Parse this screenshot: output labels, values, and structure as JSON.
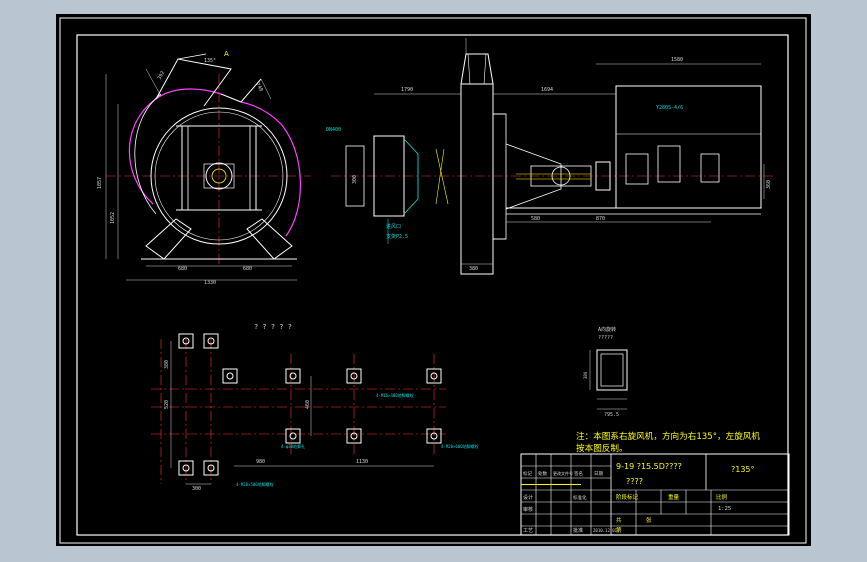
{
  "colors": {
    "background": "#000000",
    "frame": "#ffffff",
    "outline": "#ffffff",
    "dimension": "#d8d8d8",
    "centerline": "#ff3030",
    "volute": "#ff40ff",
    "annotation": "#00d8d8",
    "highlight": "#ffff00",
    "window_chrome": "#b9c6d2"
  },
  "drawing": {
    "detail_title": "? ? ? ? ?",
    "view_label": "A向旋转",
    "view_sub": "?????",
    "note_line1": "注：本图系右旋风机，方向为右135°，左旋风机",
    "note_line2": "按本图反制。",
    "angle_top": "135°",
    "view_letter": "A",
    "motor_label": "Y280S-4/6",
    "flange_label": "DN400",
    "elbow_label": "进风口",
    "support_label": "支架P2.5",
    "dims": {
      "front_h": "1057",
      "front_h2": "1052",
      "front_w_left": "680",
      "front_w_right": "680",
      "front_w_total": "1330",
      "outlet_a": "392",
      "outlet_b": "740",
      "side_a": "1790",
      "side_b": "1694",
      "side_c": "1580",
      "side_d": "380",
      "side_e": "580",
      "side_f": "870",
      "side_g": "360",
      "side_h": "300",
      "small_a": "380",
      "small_b": "630",
      "plan_a": "980",
      "plan_b": "1130",
      "plan_c": "300",
      "plan_d": "520",
      "plan_e": "460",
      "plan_f": "380",
      "view_w": "?95.5",
      "view_h": "380"
    },
    "plan_notes": {
      "bolt_a": "4-M20×500地脚螺栓",
      "bolt_b": "4-φ30地脚孔",
      "bolt_c": "4-M16×400地脚螺栓",
      "bolt_d": "4-M20×600地脚螺栓"
    }
  },
  "title_block": {
    "project": "9-19 ?15.5D????",
    "project_sub": "????",
    "angle": "?135°",
    "rev_label": "标记",
    "count_label": "处数",
    "file_label": "更改文件号",
    "sign_label": "签名",
    "date_label": "日期",
    "design": "设计",
    "check": "审核",
    "standard": "标准化",
    "process": "工艺",
    "approve": "批准",
    "stage": "阶段标记",
    "weight": "重量",
    "scale_label": "比例",
    "scale": "1:25",
    "sheet": "共",
    "page": "第",
    "date": "2010.12.01",
    "sheet_count": "张"
  }
}
